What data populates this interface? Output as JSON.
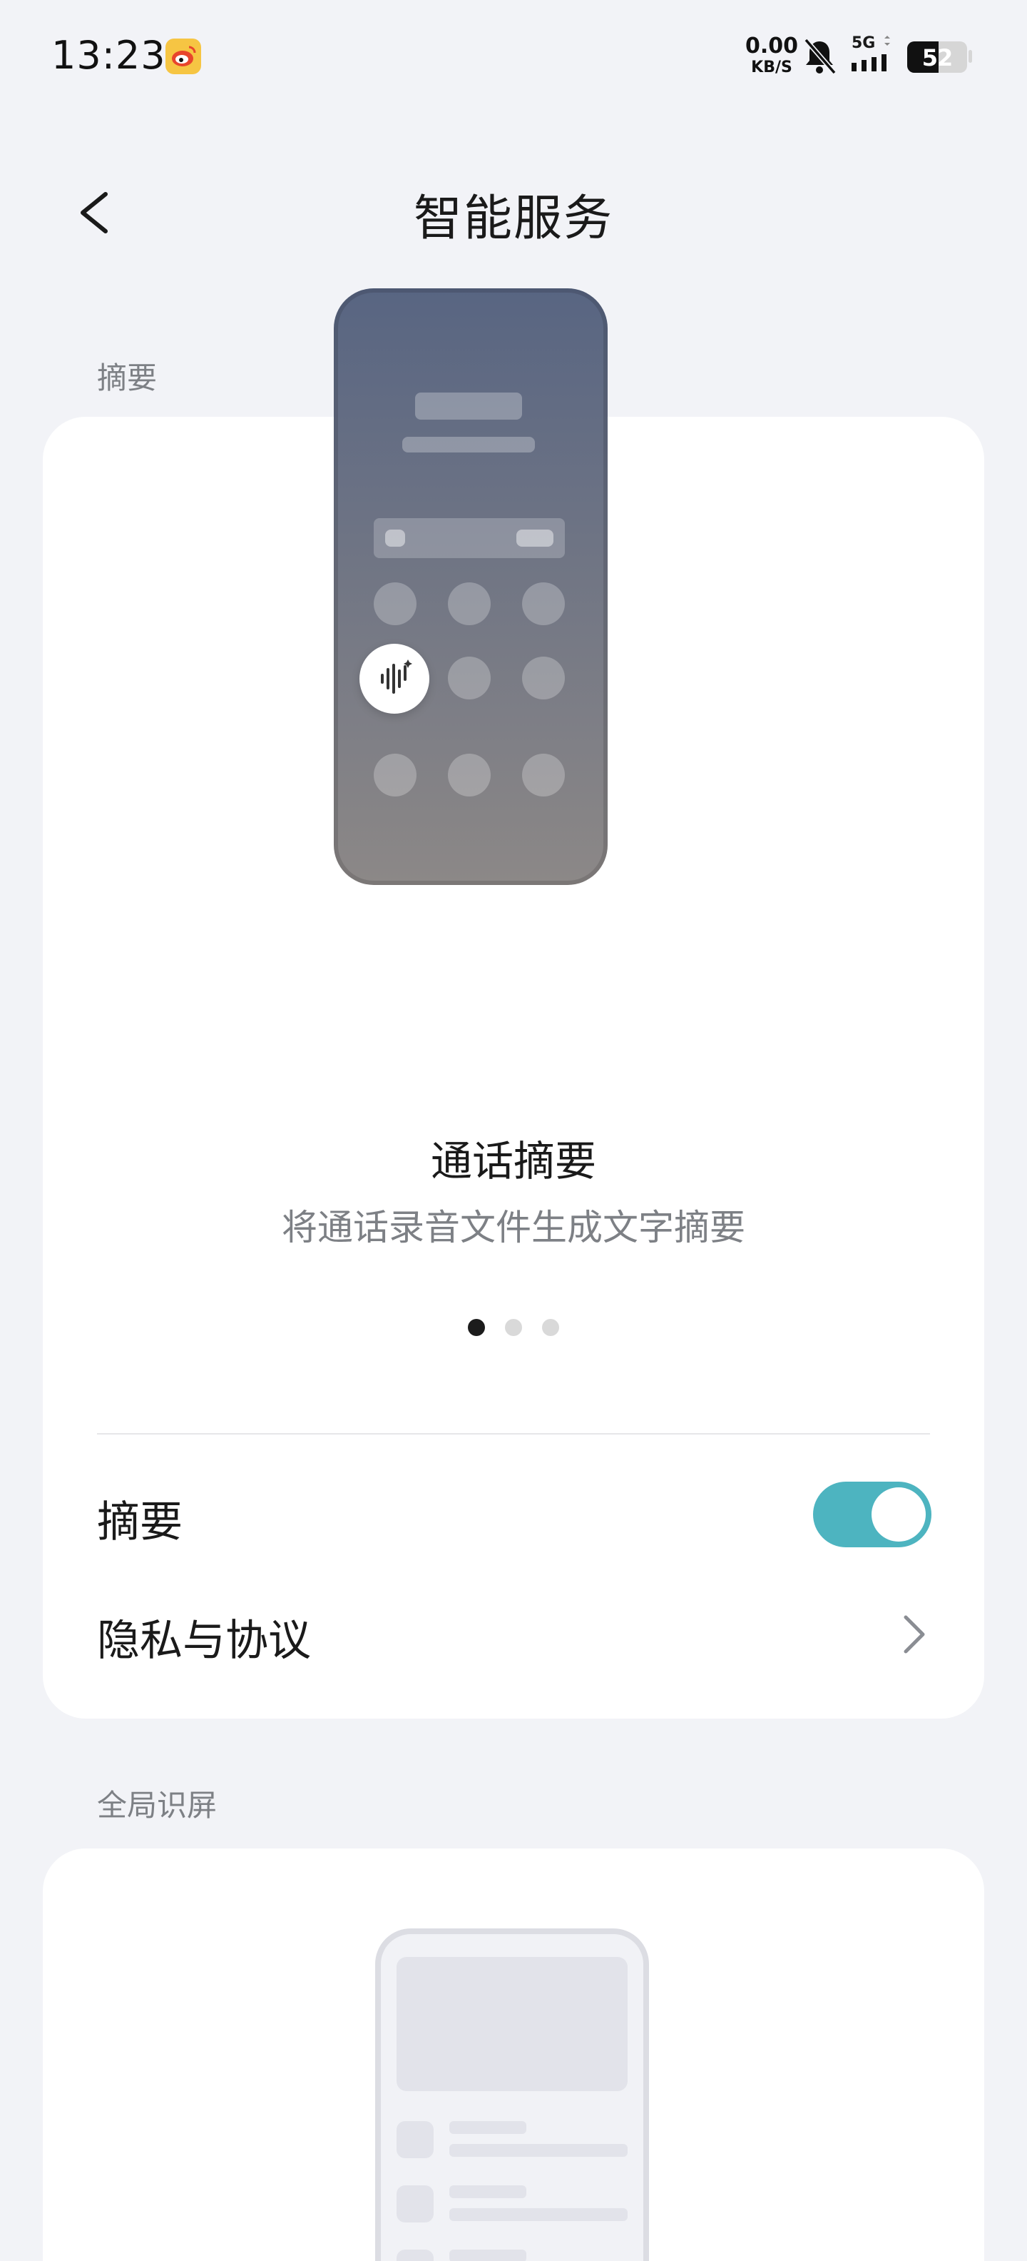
{
  "status_bar": {
    "time": "13:23",
    "net_speed_value": "0.00",
    "net_speed_unit": "KB/S",
    "network": "5G",
    "battery": "52",
    "battery_level": 0.52,
    "app_icon": "weibo-icon",
    "notification_icon": "bell-muted-icon"
  },
  "header": {
    "title": "智能服务",
    "back_icon": "back-arrow-icon"
  },
  "sections": {
    "summary": {
      "label": "摘要",
      "illustration_icon": "voice-wave-icon",
      "feature_title": "通话摘要",
      "feature_subtitle": "将通话录音文件生成文字摘要",
      "pager": {
        "pages": 3,
        "current": 1
      },
      "toggle_label": "摘要",
      "toggle_on": true,
      "privacy_label": "隐私与协议"
    },
    "screen_recognition": {
      "label": "全局识屏"
    }
  },
  "colors": {
    "background": "#f2f3f7",
    "card": "#ffffff",
    "accent": "#4db4c0",
    "secondary_text": "#7d8085"
  }
}
